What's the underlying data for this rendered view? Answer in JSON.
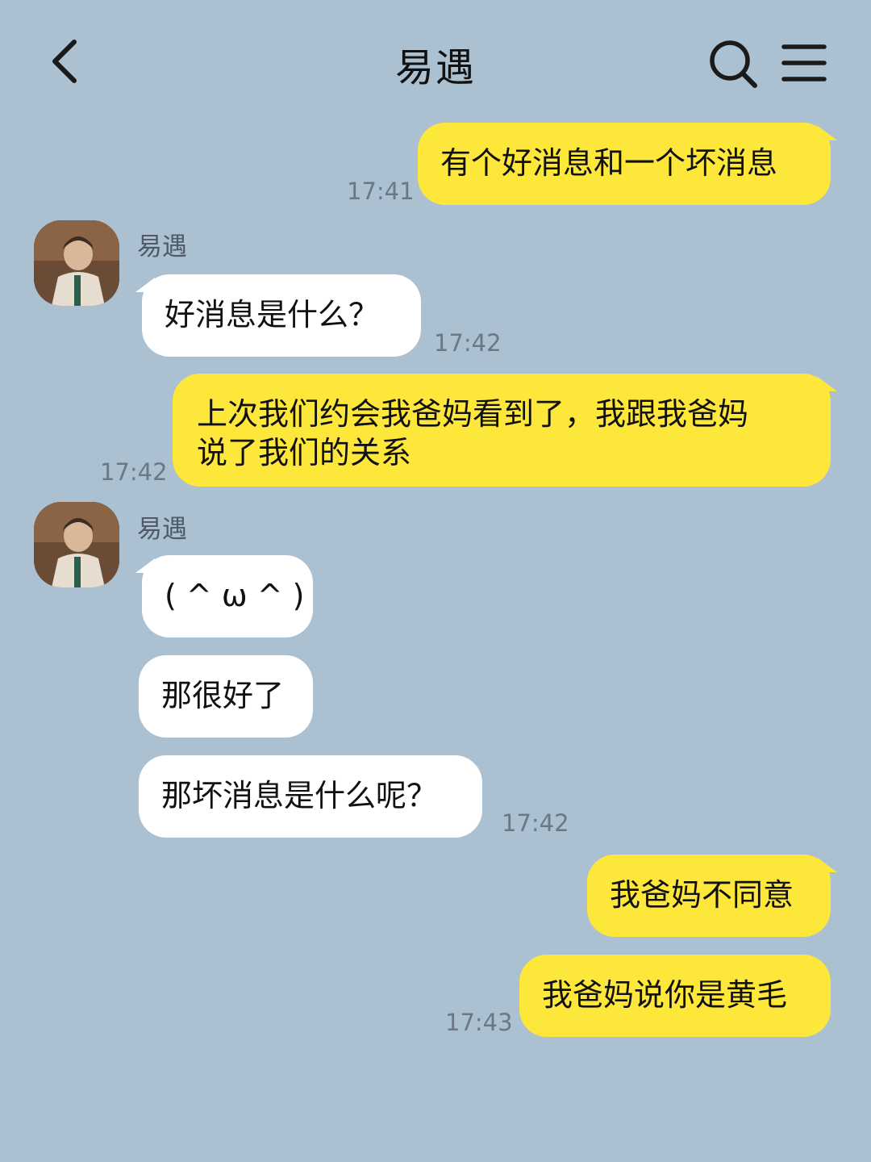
{
  "header": {
    "title": "易遇",
    "back_icon": "chevron-left-icon",
    "search_icon": "search-icon",
    "menu_icon": "menu-icon"
  },
  "colors": {
    "background": "#abc1d2",
    "my_bubble": "#fde73a",
    "their_bubble": "#ffffff",
    "timestamp": "#6b7884"
  },
  "messages": [
    {
      "from": "me",
      "text": "有个好消息和一个坏消息",
      "time": "17:41"
    },
    {
      "from": "them",
      "sender": "易遇",
      "text": "好消息是什么？",
      "time": "17:42"
    },
    {
      "from": "me",
      "line1": "上次我们约会我爸妈看到了，我跟我爸妈",
      "line2": "说了我们的关系",
      "time": "17:42"
    },
    {
      "from": "them",
      "sender": "易遇",
      "text": "( ^ ω ^ )"
    },
    {
      "from": "them",
      "text": "那很好了"
    },
    {
      "from": "them",
      "text": "那坏消息是什么呢？",
      "time": "17:42"
    },
    {
      "from": "me",
      "text": "我爸妈不同意"
    },
    {
      "from": "me",
      "text": "我爸妈说你是黄毛",
      "time": "17:43"
    }
  ]
}
